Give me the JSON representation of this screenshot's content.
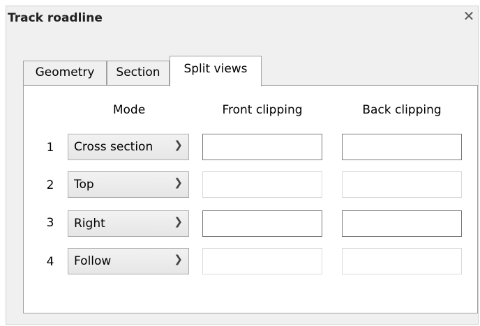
{
  "window": {
    "title": "Track roadline",
    "close_glyph": "✕"
  },
  "tabs": [
    {
      "label": "Geometry",
      "active": false
    },
    {
      "label": "Section",
      "active": false
    },
    {
      "label": "Split views",
      "active": true
    }
  ],
  "columns": {
    "mode": "Mode",
    "front": "Front clipping",
    "back": "Back clipping"
  },
  "rows": [
    {
      "num": "1",
      "mode": "Cross section",
      "front": "",
      "back": "",
      "clipping_enabled": true
    },
    {
      "num": "2",
      "mode": "Top",
      "front": "",
      "back": "",
      "clipping_enabled": false
    },
    {
      "num": "3",
      "mode": "Right",
      "front": "",
      "back": "",
      "clipping_enabled": true
    },
    {
      "num": "4",
      "mode": "Follow",
      "front": "",
      "back": "",
      "clipping_enabled": false
    }
  ],
  "icons": {
    "dropdown": "chevron-down-icon",
    "close": "close-icon"
  }
}
